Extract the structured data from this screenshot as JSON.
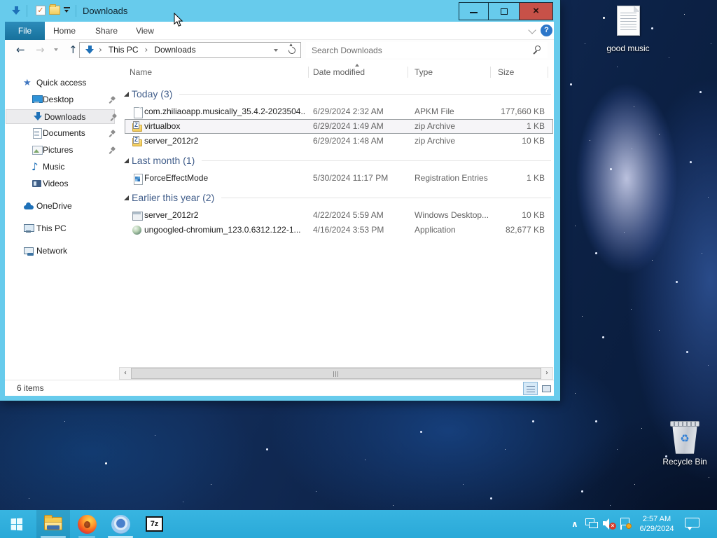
{
  "window": {
    "title": "Downloads"
  },
  "qat": {
    "icons": [
      "downloads-small",
      "properties-check",
      "new-folder",
      "customize-chevron"
    ]
  },
  "ribbon": {
    "tabs": [
      "File",
      "Home",
      "Share",
      "View"
    ],
    "help_label": "?"
  },
  "toolbar": {
    "breadcrumb": [
      "This PC",
      "Downloads"
    ],
    "search_placeholder": "Search Downloads"
  },
  "nav": {
    "items": [
      {
        "label": "Quick access",
        "icon": "star",
        "pinned": false,
        "sel": false
      },
      {
        "label": "Desktop",
        "icon": "desktop",
        "pinned": true,
        "sel": false
      },
      {
        "label": "Downloads",
        "icon": "dlarrow",
        "pinned": true,
        "sel": true
      },
      {
        "label": "Documents",
        "icon": "doc",
        "pinned": true,
        "sel": false
      },
      {
        "label": "Pictures",
        "icon": "pic",
        "pinned": true,
        "sel": false
      },
      {
        "label": "Music",
        "icon": "music",
        "pinned": false,
        "sel": false
      },
      {
        "label": "Videos",
        "icon": "video",
        "pinned": false,
        "sel": false
      },
      {
        "label": "OneDrive",
        "icon": "cloud",
        "pinned": false,
        "sel": false
      },
      {
        "label": "This PC",
        "icon": "pc",
        "pinned": false,
        "sel": false
      },
      {
        "label": "Network",
        "icon": "net",
        "pinned": false,
        "sel": false
      }
    ]
  },
  "list": {
    "columns": [
      {
        "label": "Name"
      },
      {
        "label": "Date modified",
        "sorted": true
      },
      {
        "label": "Type"
      },
      {
        "label": "Size"
      }
    ],
    "groups": [
      {
        "label": "Today (3)",
        "items": [
          {
            "name": "com.zhiliaoapp.musically_35.4.2-2023504...",
            "date": "6/29/2024 2:32 AM",
            "type": "APKM File",
            "size": "177,660 KB",
            "icon": "file",
            "sel": false
          },
          {
            "name": "virtualbox",
            "date": "6/29/2024 1:49 AM",
            "type": "zip Archive",
            "size": "1 KB",
            "icon": "zip",
            "sel": true
          },
          {
            "name": "server_2012r2",
            "date": "6/29/2024 1:48 AM",
            "type": "zip Archive",
            "size": "10 KB",
            "icon": "zip",
            "sel": false
          }
        ]
      },
      {
        "label": "Last month (1)",
        "items": [
          {
            "name": "ForceEffectMode",
            "date": "5/30/2024 11:17 PM",
            "type": "Registration Entries",
            "size": "1 KB",
            "icon": "reg",
            "sel": false
          }
        ]
      },
      {
        "label": "Earlier this year (2)",
        "items": [
          {
            "name": "server_2012r2",
            "date": "4/22/2024 5:59 AM",
            "type": "Windows Desktop...",
            "size": "10 KB",
            "icon": "rdp",
            "sel": false
          },
          {
            "name": "ungoogled-chromium_123.0.6312.122-1...",
            "date": "4/16/2024 3:53 PM",
            "type": "Application",
            "size": "82,677 KB",
            "icon": "app",
            "sel": false
          }
        ]
      }
    ]
  },
  "statusbar": {
    "items_count": "6 items"
  },
  "desktop": {
    "icons": [
      {
        "label": "good music"
      },
      {
        "label": "Recycle Bin"
      }
    ]
  },
  "taskbar": {
    "apps": [
      "start",
      "file-explorer",
      "firefox",
      "chromium",
      "7-zip"
    ],
    "sevenzip_label": "7z",
    "tray": {
      "clock_time": "2:57 AM",
      "clock_date": "6/29/2024"
    }
  }
}
